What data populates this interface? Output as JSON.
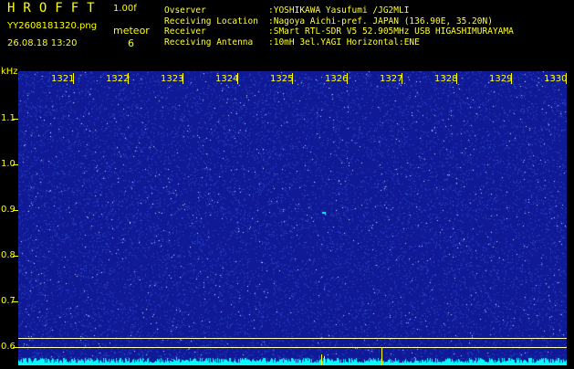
{
  "app": {
    "title": "HROFFT",
    "version": "1.00f"
  },
  "file": {
    "name": "YY2608181320.png",
    "timestamp": "26.08.18 13:20"
  },
  "meteor": {
    "label": "meteor",
    "count": "6"
  },
  "station": [
    {
      "key": "Ovserver",
      "value": ":YOSHIKAWA Yasufumi /JG2MLI"
    },
    {
      "key": "Receiving Location",
      "value": ":Nagoya Aichi-pref. JAPAN (136.90E, 35.20N)"
    },
    {
      "key": "Receiver",
      "value": ":SMart RTL-SDR V5 52.905MHz USB HIGASHIMURAYAMA"
    },
    {
      "key": "Receiving Antenna",
      "value": ":10mH 3el.YAGI Horizontal:ENE"
    }
  ],
  "plot": {
    "y_unit": "kHz",
    "y_ticks": [
      "1.1",
      "1.0",
      "0.9",
      "0.8",
      "0.7",
      "0.6"
    ],
    "x_ticks": [
      "1321",
      "1322",
      "1323",
      "1324",
      "1325",
      "1326",
      "1327",
      "1328",
      "1329",
      "1330"
    ],
    "colors": {
      "background": "#101a96",
      "noise_dim": "#2e4cd0",
      "noise_bright": "#c8e0ff",
      "echo": "#00ffff",
      "axis": "#ffff00"
    }
  }
}
